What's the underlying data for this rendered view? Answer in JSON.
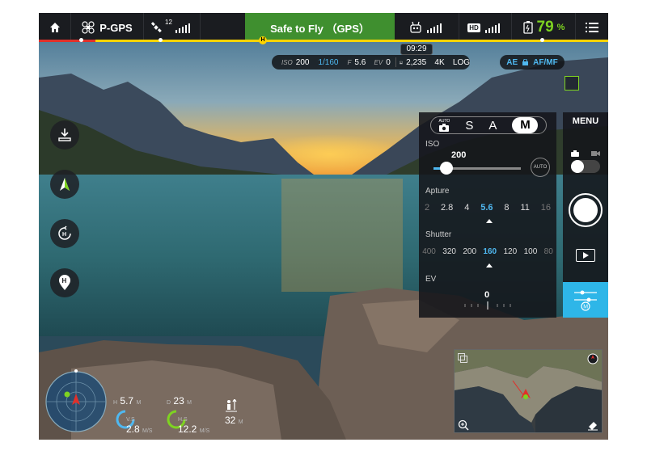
{
  "topbar": {
    "home_icon": "home-icon",
    "flight_mode": "P-GPS",
    "satellites": "12",
    "status": "Safe to Fly （GPS）",
    "video_label": "HD",
    "battery_percent": "79",
    "battery_unit": "%",
    "menu_icon": "list-icon"
  },
  "time": "09:29",
  "camera_params": {
    "iso_label": "ISO",
    "iso": "200",
    "shutter": "1/160",
    "f_label": "F",
    "aperture": "5.6",
    "ev_label": "EV",
    "ev": "0",
    "photo_count": "2,235",
    "resolution": "4K",
    "format": "LOG",
    "ae": "AE",
    "af": "AF/MF"
  },
  "left_buttons": [
    "takeoff-icon",
    "compass-arrow-icon",
    "return-home-icon",
    "home-point-icon"
  ],
  "panel": {
    "mode_auto": "AUTO",
    "modes": [
      "S",
      "A",
      "M"
    ],
    "iso_title": "ISO",
    "iso_value": "200",
    "iso_slider_level": 0.15,
    "iso_auto": "AUTO",
    "aperture_title": "Apture",
    "apertures": [
      "2",
      "2.8",
      "4",
      "5.6",
      "8",
      "11",
      "16"
    ],
    "aperture_selected": "5.6",
    "shutter_title": "Shutter",
    "shutters": [
      "400",
      "320",
      "200",
      "160",
      "120",
      "100",
      "80"
    ],
    "shutter_selected": "160",
    "ev_title": "EV",
    "ev_value": "0"
  },
  "rail": {
    "menu": "MENU"
  },
  "telemetry": {
    "h_label": "H",
    "h_value": "5.7",
    "h_unit": "M",
    "d_label": "D",
    "d_value": "23",
    "d_unit": "M",
    "vs_label": "V.S",
    "vs_value": "2.8",
    "vs_unit": "M/S",
    "hs_label": "H.S",
    "hs_value": "12.2",
    "hs_unit": "M/S",
    "alt_value": "32",
    "alt_unit": "M"
  },
  "colors": {
    "safe": "#3f8f2f",
    "accent": "#4fb8f0",
    "battery": "#7ed321",
    "progress": "#ffd400"
  }
}
